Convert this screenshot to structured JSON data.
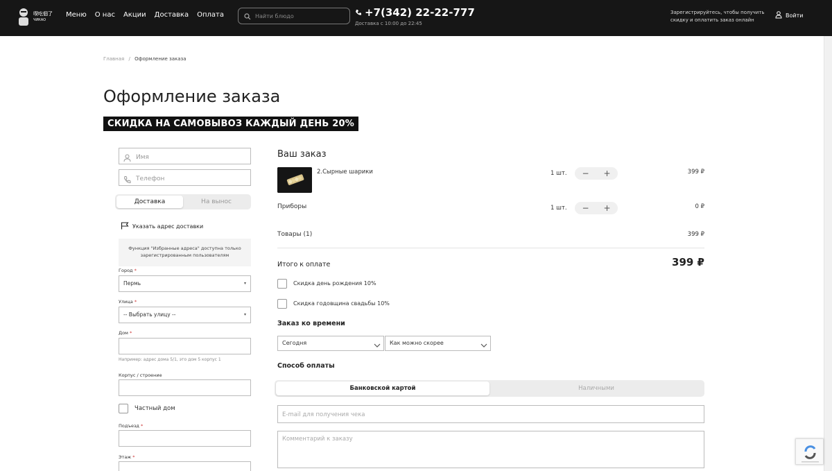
{
  "header": {
    "logo_text": "喫吃個了",
    "logo_sub": "ЧИКАО",
    "nav": [
      "Меню",
      "О нас",
      "Акции",
      "Доставка",
      "Оплата"
    ],
    "search_placeholder": "Найти блюдо",
    "phone": "+7(342) 22-22-777",
    "hours": "Доставка с 10:00 до 22:45",
    "register_text": "Зарегистрируйтесь, чтобы получить скидку и оплатить заказ онлайн",
    "login_label": "Войти"
  },
  "breadcrumb": {
    "home": "Главная",
    "sep": "/",
    "current": "Оформление заказа"
  },
  "page_title": "Оформление заказа",
  "promo": "СКИДКА НА САМОВЫВОЗ КАЖДЫЙ ДЕНЬ 20%",
  "form": {
    "name_placeholder": "Имя",
    "phone_placeholder": "Телефон",
    "delivery_tabs": [
      "Доставка",
      "На вынос"
    ],
    "address_link": "Указать адрес доставки",
    "favorites_notice": "Функция \"Избранные адреса\" доступна только зарегистрированным пользователям",
    "city_label": "Город",
    "city_value": "Пермь",
    "street_label": "Улица",
    "street_value": "-- Выбрать улицу --",
    "house_label": "Дом",
    "house_hint": "Например: адрес дома 5/1, это дом 5 корпус 1",
    "building_label": "Корпус / строение",
    "private_house_label": "Частный дом",
    "entrance_label": "Подъезд",
    "floor_label": "Этаж",
    "required_mark": "*"
  },
  "order": {
    "title": "Ваш заказ",
    "items": [
      {
        "name": "2.Сырные шарики",
        "qty": "1",
        "unit": "шт.",
        "price": "399 ₽"
      },
      {
        "name": "Приборы",
        "qty": "1",
        "unit": "шт.",
        "price": "0 ₽"
      }
    ],
    "goods_label": "Товары (1)",
    "goods_price": "399 ₽",
    "total_label": "Итого к оплате",
    "total_value": "399 ₽",
    "discounts": [
      "Скидка день рождения 10%",
      "Скидка годовщина свадьбы 10%"
    ],
    "time_section": "Заказ ко времени",
    "time_day": "Сегодня",
    "time_slot": "Как можно скорее",
    "payment_section": "Способ оплаты",
    "payment_tabs": [
      "Банковской картой",
      "Наличными"
    ],
    "email_placeholder": "E-mail для получения чека",
    "comment_placeholder": "Комментарий к заказу"
  }
}
